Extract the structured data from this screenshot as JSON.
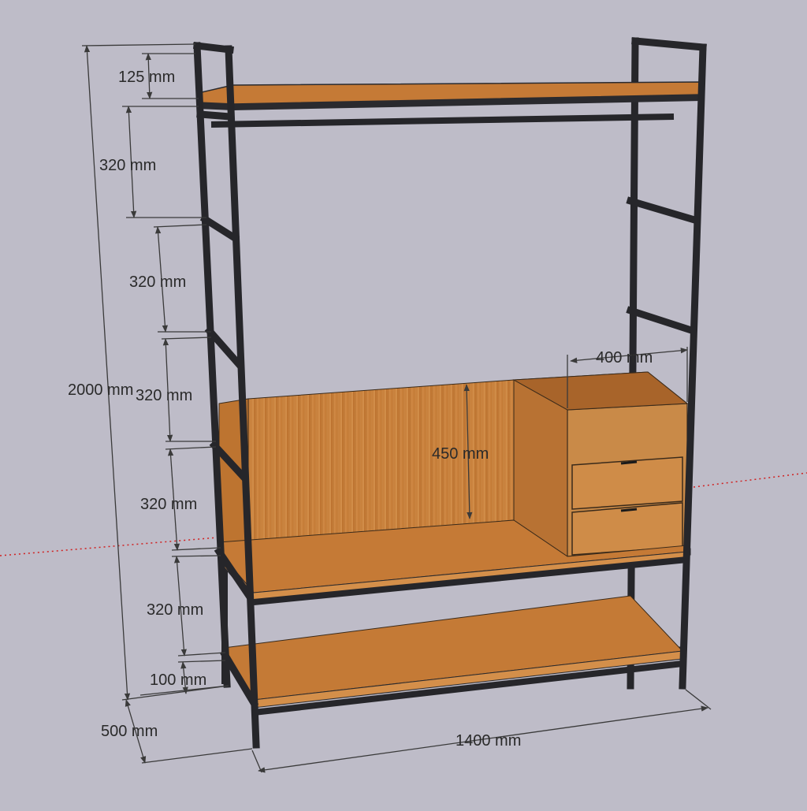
{
  "scene": {
    "background_color": "#bebcc8",
    "frame_color": "#2a2a2e",
    "wood_color": "#c9803a",
    "dimension_line_color": "#3a3a3a",
    "guide_line_color": "#d02020"
  },
  "dimensions": {
    "total_height": "2000 mm",
    "top_gap": "125 mm",
    "rung_spacing_1": "320 mm",
    "rung_spacing_2": "320 mm",
    "rung_spacing_3": "320 mm",
    "rung_spacing_4": "320 mm",
    "rung_spacing_5": "320 mm",
    "bottom_clearance": "100 mm",
    "depth": "500 mm",
    "width": "1400 mm",
    "cabinet_width": "400 mm",
    "back_panel_height": "450 mm"
  }
}
